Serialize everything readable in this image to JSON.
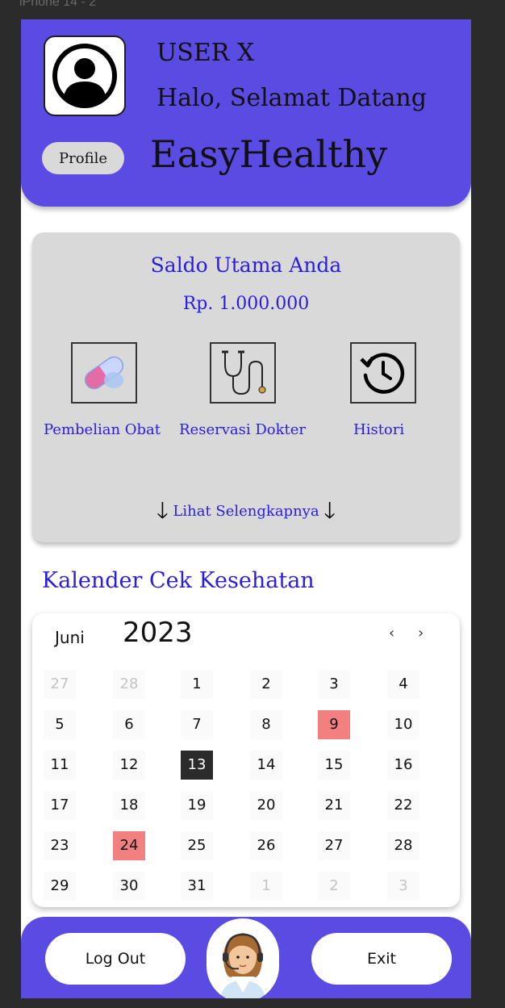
{
  "frame_label": "iPhone 14 - 2",
  "header": {
    "user_name": "USER X",
    "greeting": "Halo, Selamat Datang",
    "profile_label": "Profile",
    "app_name": "EasyHealthy",
    "accent_color": "#5a4ce3"
  },
  "balance": {
    "title": "Saldo Utama Anda",
    "amount": "Rp. 1.000.000",
    "services": [
      {
        "label": "Pembelian Obat",
        "icon": "pill-icon"
      },
      {
        "label": "Reservasi Dokter",
        "icon": "stethoscope-icon"
      },
      {
        "label": "Histori",
        "icon": "history-icon"
      }
    ],
    "see_more": "Lihat Selengkapnya"
  },
  "calendar": {
    "heading": "Kalender Cek Kesehatan",
    "month": "Juni",
    "year": "2023",
    "prev": "‹",
    "next": "›",
    "weeks": [
      [
        "27",
        "28",
        "1",
        "2",
        "3",
        "4"
      ],
      [
        "5",
        "6",
        "7",
        "8",
        "9",
        "10"
      ],
      [
        "11",
        "12",
        "13",
        "14",
        "15",
        "16"
      ],
      [
        "17",
        "18",
        "19",
        "20",
        "21",
        "22"
      ],
      [
        "23",
        "24",
        "25",
        "26",
        "27",
        "28"
      ],
      [
        "29",
        "30",
        "31",
        "1",
        "2",
        "3"
      ]
    ],
    "marked_dates": [
      "9",
      "24"
    ],
    "selected_date": "13",
    "marked_color": "#f28080"
  },
  "footer": {
    "logout_label": "Log Out",
    "exit_label": "Exit",
    "agent_icon": "customer-service-avatar"
  }
}
